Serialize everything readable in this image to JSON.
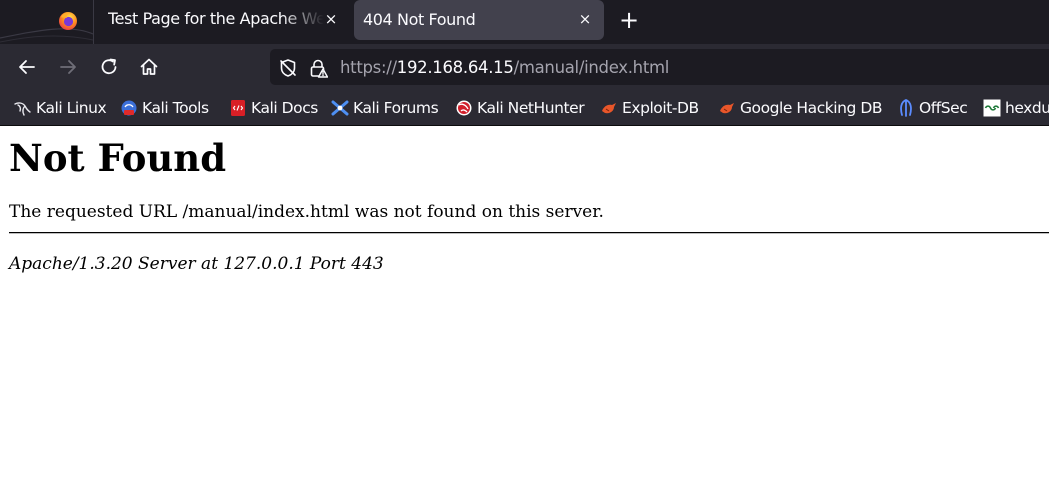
{
  "browser": {
    "tabs": [
      {
        "title": "Test Page for the Apache Web Server on Red Hat Linux",
        "close_icon": "×",
        "active": false
      },
      {
        "title": "404 Not Found",
        "close_icon": "×",
        "active": true
      }
    ],
    "new_tab_icon": "+",
    "nav": {
      "back_icon": "arrow-left-icon",
      "forward_icon": "arrow-right-icon",
      "reload_icon": "reload-icon",
      "home_icon": "home-icon"
    },
    "url": {
      "scheme": "https://",
      "host": "192.168.64.15",
      "path": "/manual/index.html"
    },
    "bookmarks": [
      {
        "label": "Kali Linux",
        "icon": "kali-dragon-icon"
      },
      {
        "label": "Kali Tools",
        "icon": "kali-tools-icon"
      },
      {
        "label": "Kali Docs",
        "icon": "kali-docs-icon"
      },
      {
        "label": "Kali Forums",
        "icon": "kali-forums-icon"
      },
      {
        "label": "Kali NetHunter",
        "icon": "nethunter-icon"
      },
      {
        "label": "Exploit-DB",
        "icon": "exploit-db-icon"
      },
      {
        "label": "Google Hacking DB",
        "icon": "ghdb-icon"
      },
      {
        "label": "OffSec",
        "icon": "offsec-icon"
      },
      {
        "label": "hexdu",
        "icon": "hexdump-icon"
      }
    ]
  },
  "page": {
    "heading": "Not Found",
    "message": "The requested URL /manual/index.html was not found on this server.",
    "address": "Apache/1.3.20 Server at 127.0.0.1 Port 443"
  },
  "colors": {
    "tabbar_bg": "#1c1b22",
    "toolbar_bg": "#2b2a33",
    "active_tab_bg": "#42414d",
    "urlbar_bg": "#1c1b22",
    "text_light": "#fbfbfe",
    "page_bg": "#ffffff"
  }
}
